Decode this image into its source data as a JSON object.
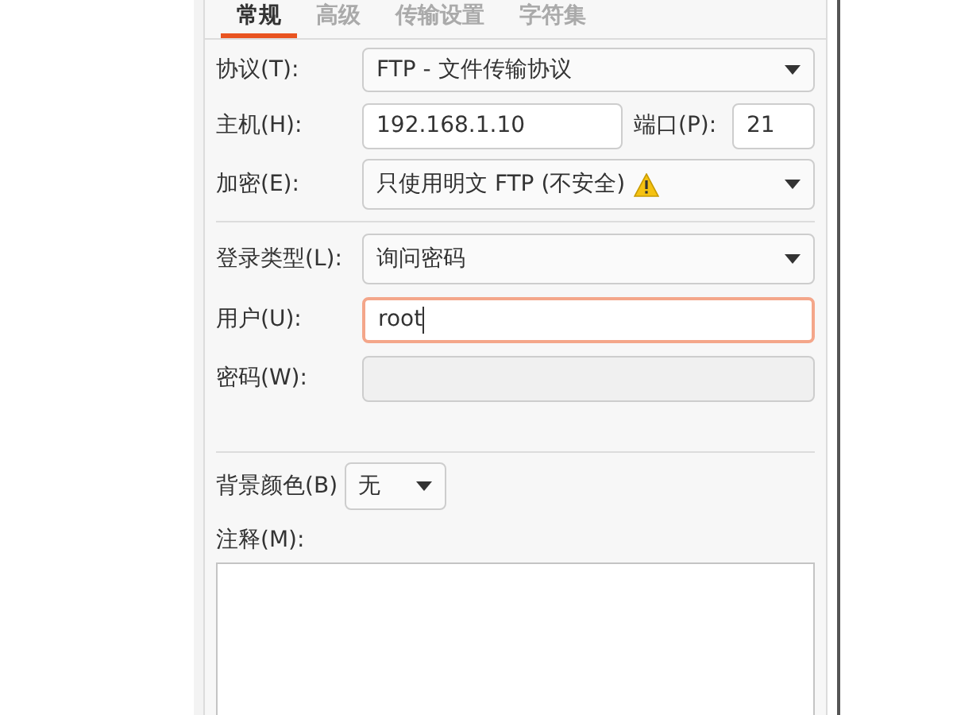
{
  "tabs": [
    {
      "label": "常规",
      "selected": true
    },
    {
      "label": "高级",
      "selected": false
    },
    {
      "label": "传输设置",
      "selected": false
    },
    {
      "label": "字符集",
      "selected": false
    }
  ],
  "protocol": {
    "label": "协议(T):",
    "value": "FTP - 文件传输协议"
  },
  "host": {
    "label": "主机(H):",
    "value": "192.168.1.10"
  },
  "port": {
    "label": "端口(P):",
    "value": "21"
  },
  "encryption": {
    "label": "加密(E):",
    "value": "只使用明文 FTP (不安全)",
    "warning": true
  },
  "logon_type": {
    "label": "登录类型(L):",
    "value": "询问密码"
  },
  "user": {
    "label": "用户(U):",
    "value": "root",
    "focused": true
  },
  "password": {
    "label": "密码(W):",
    "disabled": true
  },
  "background_color": {
    "label": "背景颜色(B)",
    "value": "无"
  },
  "comments": {
    "label": "注释(M):"
  }
}
